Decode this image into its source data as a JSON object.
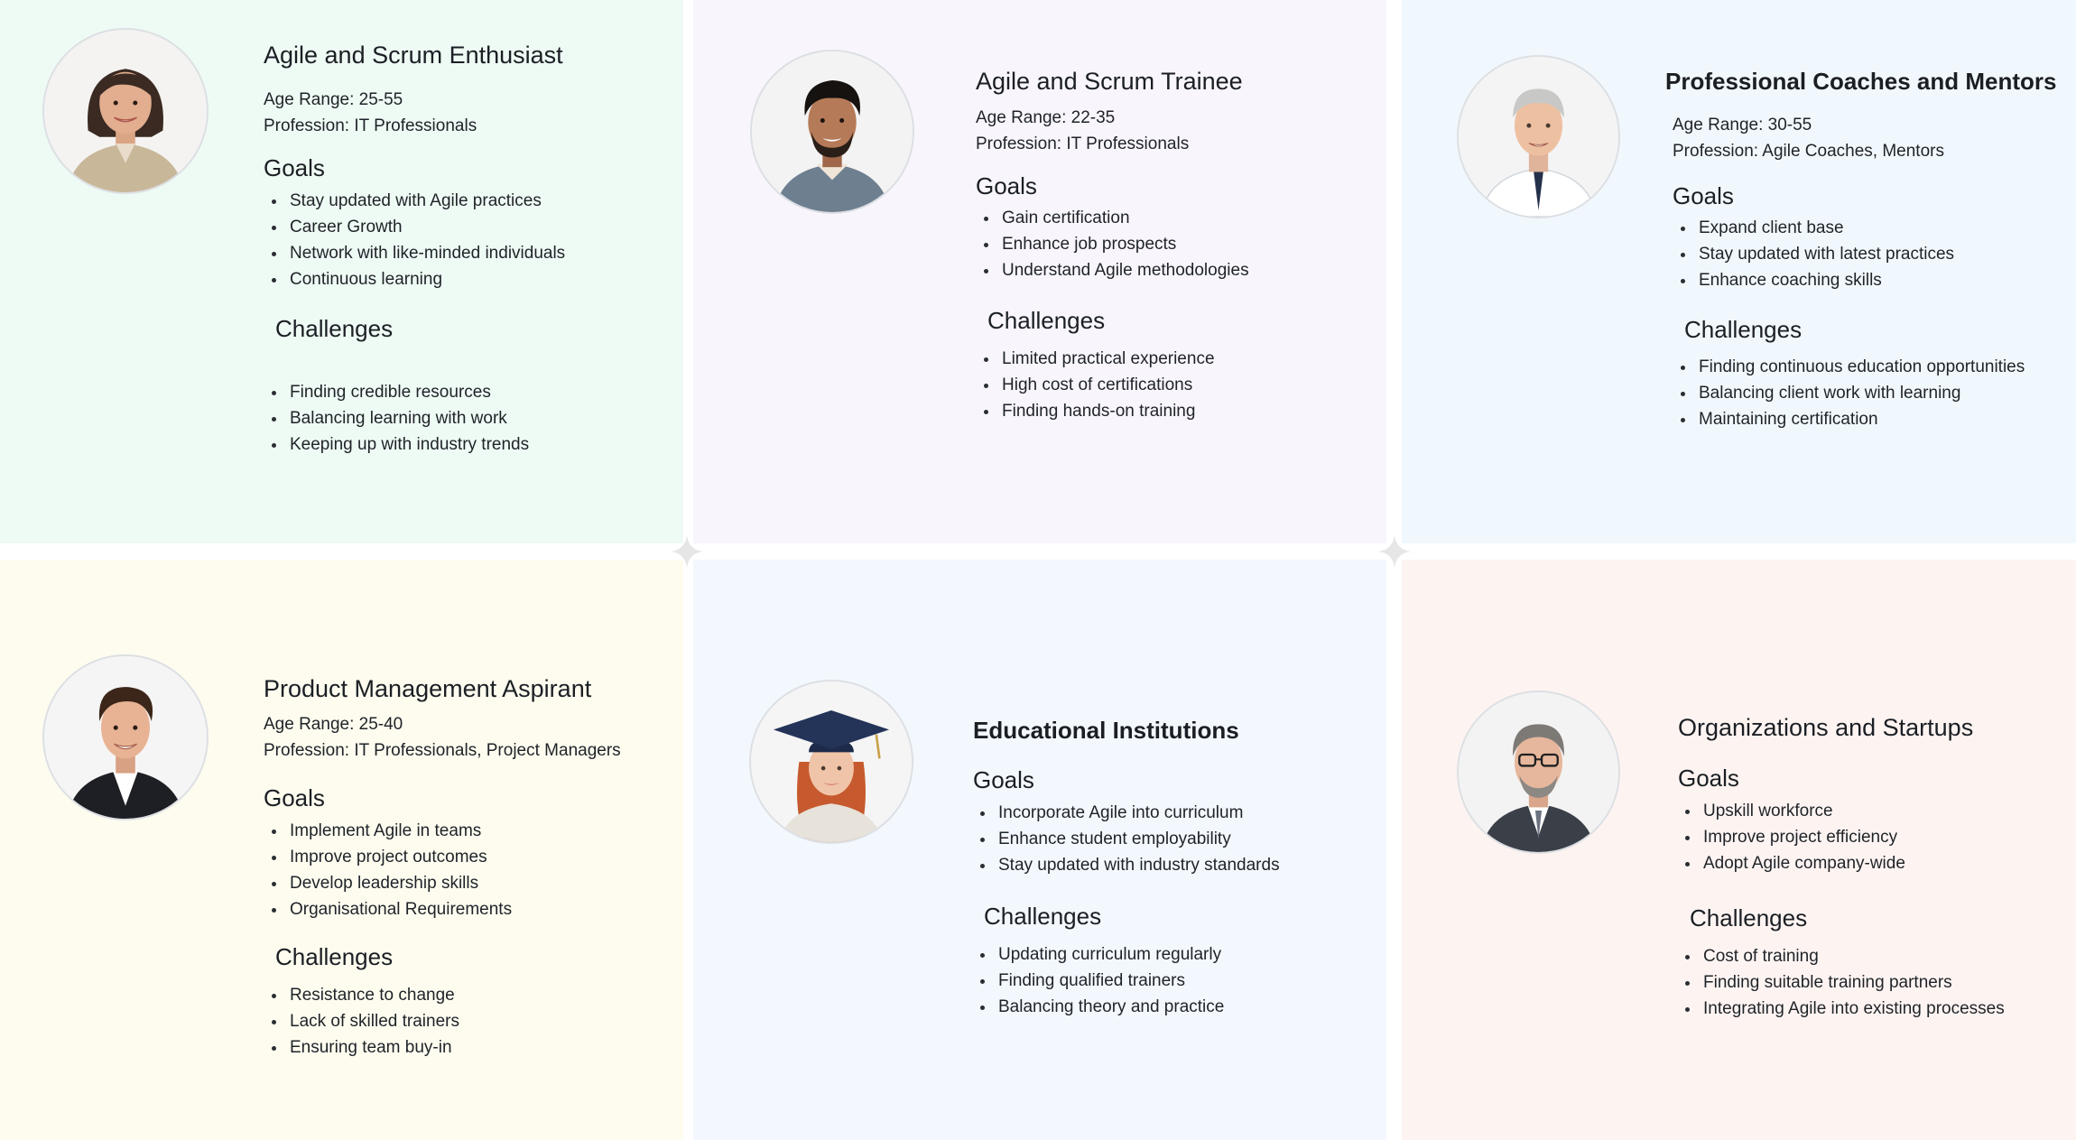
{
  "colors": {
    "mint": "#eefaf4",
    "lavender": "#f8f5fd",
    "ice": "#f1f8fd",
    "cream": "#fdfcef",
    "sky": "#f3f8fe",
    "blush": "#fdf4f2"
  },
  "section_labels": {
    "goals": "Goals",
    "challenges": "Challenges"
  },
  "personas": [
    {
      "title": "Agile and Scrum Enthusiast",
      "age_range": "Age Range: 25-55",
      "profession": "Profession: IT Professionals",
      "avatar_icon": "woman-portrait-icon",
      "goals": [
        "Stay updated with Agile practices",
        "Career Growth",
        "Network with like-minded individuals",
        "Continuous learning"
      ],
      "challenges": [
        "Finding credible resources",
        "Balancing learning with work",
        "Keeping up with industry trends"
      ]
    },
    {
      "title": "Agile and Scrum Trainee",
      "age_range": "Age Range: 22-35",
      "profession": "Profession: IT Professionals",
      "avatar_icon": "young-man-portrait-icon",
      "goals": [
        "Gain certification",
        "Enhance job prospects",
        "Understand Agile methodologies"
      ],
      "challenges": [
        "Limited practical experience",
        "High cost of certifications",
        "Finding hands-on training"
      ]
    },
    {
      "title": "Professional Coaches and Mentors",
      "age_range": "Age Range: 30-55",
      "profession": "Profession: Agile Coaches, Mentors",
      "avatar_icon": "senior-man-portrait-icon",
      "goals": [
        "Expand client base",
        "Stay updated with latest practices",
        "Enhance coaching skills"
      ],
      "challenges": [
        "Finding continuous education opportunities",
        "Balancing client work with learning",
        "Maintaining certification"
      ]
    },
    {
      "title": "Product Management Aspirant",
      "age_range": "Age Range: 25-40",
      "profession": "Profession: IT Professionals, Project Managers",
      "avatar_icon": "man-in-suit-portrait-icon",
      "goals": [
        "Implement Agile in teams",
        "Improve project outcomes",
        "Develop leadership skills",
        "Organisational Requirements"
      ],
      "challenges": [
        "Resistance to change",
        "Lack of skilled trainers",
        "Ensuring team buy-in"
      ]
    },
    {
      "title": "Educational Institutions",
      "avatar_icon": "graduate-portrait-icon",
      "goals": [
        "Incorporate Agile into curriculum",
        "Enhance student employability",
        "Stay updated with industry standards"
      ],
      "challenges": [
        "Updating curriculum regularly",
        "Finding qualified trainers",
        "Balancing theory and practice"
      ]
    },
    {
      "title": "Organizations and Startups",
      "avatar_icon": "executive-portrait-icon",
      "goals": [
        "Upskill workforce",
        "Improve project efficiency",
        "Adopt Agile company-wide"
      ],
      "challenges": [
        "Cost of training",
        "Finding suitable training partners",
        "Integrating Agile into existing processes"
      ]
    }
  ]
}
